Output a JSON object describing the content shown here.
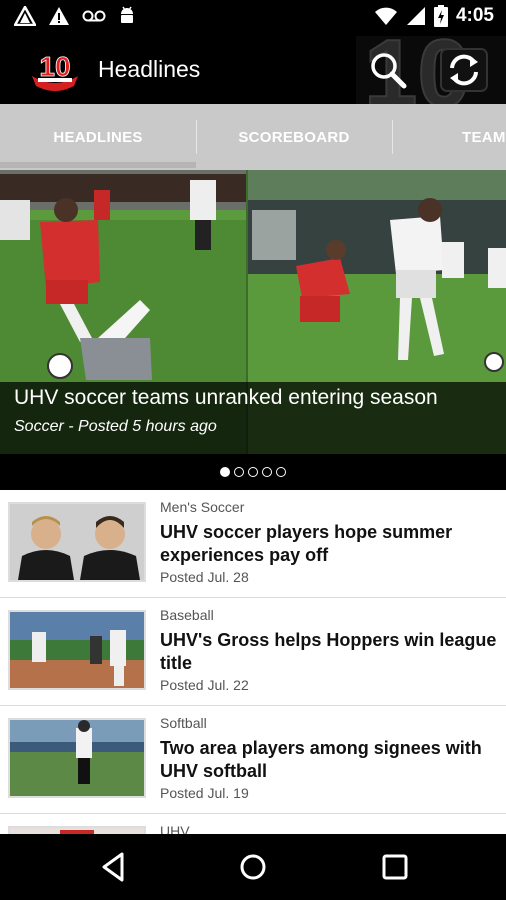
{
  "status_bar": {
    "time": "4:05",
    "icons": [
      "warning-triangle-icon",
      "voicemail-icon",
      "android-icon",
      "wifi-icon",
      "signal-icon",
      "battery-charging-icon"
    ]
  },
  "app_bar": {
    "title": "Headlines",
    "logo_text": "10",
    "icons": [
      "search-icon",
      "refresh-icon"
    ]
  },
  "tabs": [
    {
      "label": "HEADLINES",
      "selected": true
    },
    {
      "label": "SCOREBOARD",
      "selected": false
    },
    {
      "label": "TEAM",
      "selected": false
    }
  ],
  "hero": {
    "title": "UHV soccer teams unranked entering season",
    "subtitle": "Soccer - Posted 5 hours ago",
    "pages": 5,
    "active_page": 1
  },
  "news": [
    {
      "category": "Men's Soccer",
      "title": "UHV soccer players hope summer experiences pay off",
      "posted": "Posted Jul. 28"
    },
    {
      "category": "Baseball",
      "title": "UHV's Gross helps Hoppers win league title",
      "posted": "Posted Jul. 22"
    },
    {
      "category": "Softball",
      "title": "Two area players among signees with UHV softball",
      "posted": "Posted Jul. 19"
    },
    {
      "category": "UHV",
      "title": "",
      "posted": ""
    }
  ],
  "nav": [
    "back-icon",
    "home-icon",
    "recents-icon"
  ]
}
